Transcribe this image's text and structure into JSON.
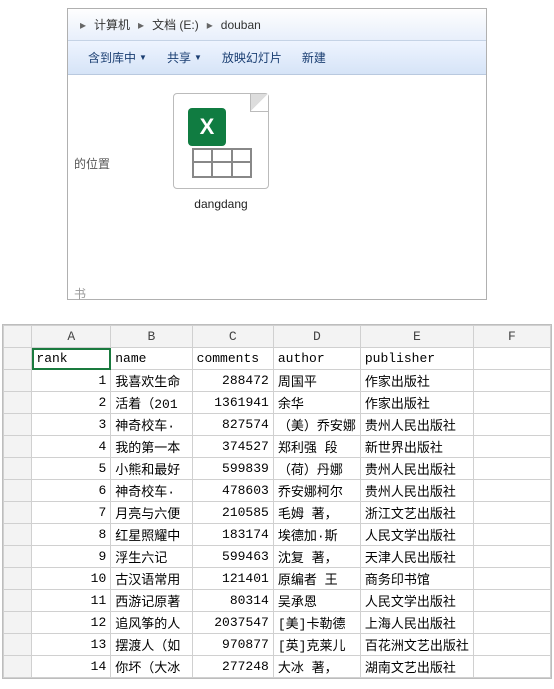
{
  "explorer": {
    "crumbs": [
      "计算机",
      "文档 (E:)",
      "douban"
    ],
    "toolbar": {
      "include": "含到库中",
      "share": "共享",
      "slideshow": "放映幻灯片",
      "new": "新建"
    },
    "side_label": "的位置",
    "file_name": "dangdang"
  },
  "sheet": {
    "columns": [
      "A",
      "B",
      "C",
      "D",
      "E",
      "F"
    ],
    "headers": {
      "rank": "rank",
      "name": "name",
      "comments": "comments",
      "author": "author",
      "publisher": "publisher"
    },
    "rows": [
      {
        "rank": "1",
        "name": "我喜欢生命",
        "comments": "288472",
        "author": "周国平",
        "publisher": "作家出版社"
      },
      {
        "rank": "2",
        "name": "活着（201",
        "comments": "1361941",
        "author": "余华",
        "publisher": "作家出版社"
      },
      {
        "rank": "3",
        "name": "神奇校车·",
        "comments": "827574",
        "author": "（美）乔安娜",
        "publisher": "贵州人民出版社"
      },
      {
        "rank": "4",
        "name": "我的第一本",
        "comments": "374527",
        "author": "郑利强 段",
        "publisher": "新世界出版社"
      },
      {
        "rank": "5",
        "name": "小熊和最好",
        "comments": "599839",
        "author": "（荷）丹娜",
        "publisher": "贵州人民出版社"
      },
      {
        "rank": "6",
        "name": "神奇校车·",
        "comments": "478603",
        "author": "乔安娜柯尔",
        "publisher": "贵州人民出版社"
      },
      {
        "rank": "7",
        "name": "月亮与六便",
        "comments": "210585",
        "author": "毛姆 著，",
        "publisher": "浙江文艺出版社"
      },
      {
        "rank": "8",
        "name": "红星照耀中",
        "comments": "183174",
        "author": "埃德加·斯",
        "publisher": "人民文学出版社"
      },
      {
        "rank": "9",
        "name": "浮生六记",
        "comments": "599463",
        "author": "沈复 著，",
        "publisher": "天津人民出版社"
      },
      {
        "rank": "10",
        "name": "古汉语常用",
        "comments": "121401",
        "author": "原编者 王",
        "publisher": "商务印书馆"
      },
      {
        "rank": "11",
        "name": "西游记原著",
        "comments": "80314",
        "author": "吴承恩",
        "publisher": "人民文学出版社"
      },
      {
        "rank": "12",
        "name": "追风筝的人",
        "comments": "2037547",
        "author": "[美]卡勒德",
        "publisher": "上海人民出版社"
      },
      {
        "rank": "13",
        "name": "摆渡人（如",
        "comments": "970877",
        "author": "[英]克莱儿",
        "publisher": "百花洲文艺出版社"
      },
      {
        "rank": "14",
        "name": "你坏（大冰",
        "comments": "277248",
        "author": "大冰 著，",
        "publisher": "湖南文艺出版社"
      }
    ]
  }
}
